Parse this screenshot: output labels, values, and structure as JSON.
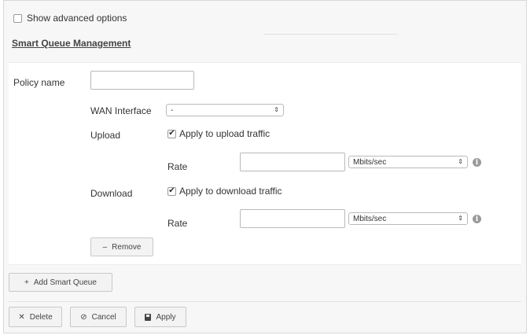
{
  "options": {
    "show_advanced_label": "Show advanced options",
    "show_advanced_checked": false
  },
  "section": {
    "title": "Smart Queue Management"
  },
  "form": {
    "policy_name": {
      "label": "Policy name",
      "value": ""
    },
    "wan_interface": {
      "label": "WAN Interface",
      "selected": "-"
    },
    "upload": {
      "label": "Upload",
      "apply_label": "Apply to upload traffic",
      "apply_checked": true,
      "rate_label": "Rate",
      "rate_value": "",
      "unit_selected": "Mbits/sec"
    },
    "download": {
      "label": "Download",
      "apply_label": "Apply to download traffic",
      "apply_checked": true,
      "rate_label": "Rate",
      "rate_value": "",
      "unit_selected": "Mbits/sec"
    },
    "remove_label": "Remove"
  },
  "actions": {
    "add_smart_queue_label": "Add Smart Queue",
    "delete_label": "Delete",
    "cancel_label": "Cancel",
    "apply_label": "Apply"
  },
  "icons": {
    "plus": "plus-icon",
    "minus": "minus-icon",
    "close": "close-icon",
    "cancel": "cancel-icon",
    "save": "save-icon",
    "info": "info-icon",
    "check": "check-icon"
  },
  "symbols": {
    "plus": "+",
    "minus": "–",
    "close": "✕",
    "cancel": "⊘",
    "info": "i",
    "check": "✔",
    "arrows": "⇕"
  }
}
